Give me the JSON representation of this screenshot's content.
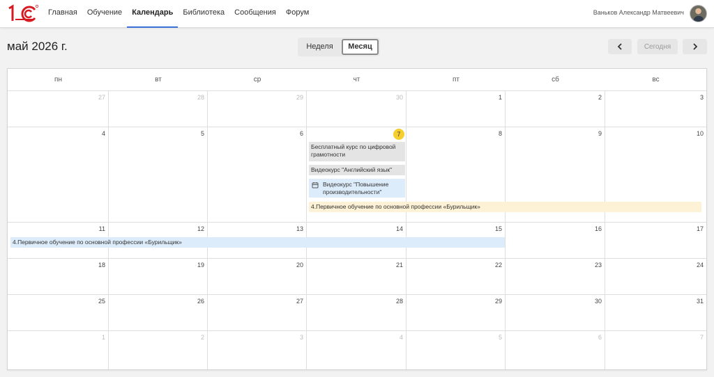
{
  "header": {
    "logo_text": "1С",
    "nav": [
      "Главная",
      "Обучение",
      "Календарь",
      "Библиотека",
      "Сообщения",
      "Форум"
    ],
    "active_nav_index": 2,
    "user_name": "Ваньков Александр Матвеевич"
  },
  "toolbar": {
    "month_title": "май 2026 г.",
    "view_week": "Неделя",
    "view_month": "Месяц",
    "active_view": "Месяц",
    "today_label": "Сегодня"
  },
  "calendar": {
    "weekdays": [
      "пн",
      "вт",
      "ср",
      "чт",
      "пт",
      "сб",
      "вс"
    ],
    "weeks": [
      [
        {
          "d": "27",
          "other": true
        },
        {
          "d": "28",
          "other": true
        },
        {
          "d": "29",
          "other": true
        },
        {
          "d": "30",
          "other": true
        },
        {
          "d": "1"
        },
        {
          "d": "2"
        },
        {
          "d": "3"
        }
      ],
      [
        {
          "d": "4"
        },
        {
          "d": "5"
        },
        {
          "d": "6"
        },
        {
          "d": "7",
          "today": true
        },
        {
          "d": "8"
        },
        {
          "d": "9"
        },
        {
          "d": "10"
        }
      ],
      [
        {
          "d": "11"
        },
        {
          "d": "12"
        },
        {
          "d": "13"
        },
        {
          "d": "14"
        },
        {
          "d": "15"
        },
        {
          "d": "16"
        },
        {
          "d": "17"
        }
      ],
      [
        {
          "d": "18"
        },
        {
          "d": "19"
        },
        {
          "d": "20"
        },
        {
          "d": "21"
        },
        {
          "d": "22"
        },
        {
          "d": "23"
        },
        {
          "d": "24"
        }
      ],
      [
        {
          "d": "25"
        },
        {
          "d": "26"
        },
        {
          "d": "27"
        },
        {
          "d": "28"
        },
        {
          "d": "29"
        },
        {
          "d": "30"
        },
        {
          "d": "31"
        }
      ],
      [
        {
          "d": "1",
          "other": true
        },
        {
          "d": "2",
          "other": true
        },
        {
          "d": "3",
          "other": true
        },
        {
          "d": "4",
          "other": true
        },
        {
          "d": "5",
          "other": true
        },
        {
          "d": "6",
          "other": true
        },
        {
          "d": "7",
          "other": true
        }
      ]
    ],
    "events": {
      "digital_course": "Бесплатный курс по цифровой грамотности",
      "english_course": "Видеокурс \"Английский язык\"",
      "productivity_course": "Видеокурс \"Повышение производительности\"",
      "driller_training_week2": "4.Первичное обучение по основной профессии «Бурильщик»",
      "driller_training_week3": "4.Первичное обучение по основной профессии «Бурильщик»"
    },
    "colors": {
      "today_badge": "#f6cf2f",
      "event_gray": "#e4e4e4",
      "event_blue": "#ddecfa",
      "event_yellow": "#fdf1d6",
      "active_tab_underline": "#3b6fd8"
    }
  }
}
